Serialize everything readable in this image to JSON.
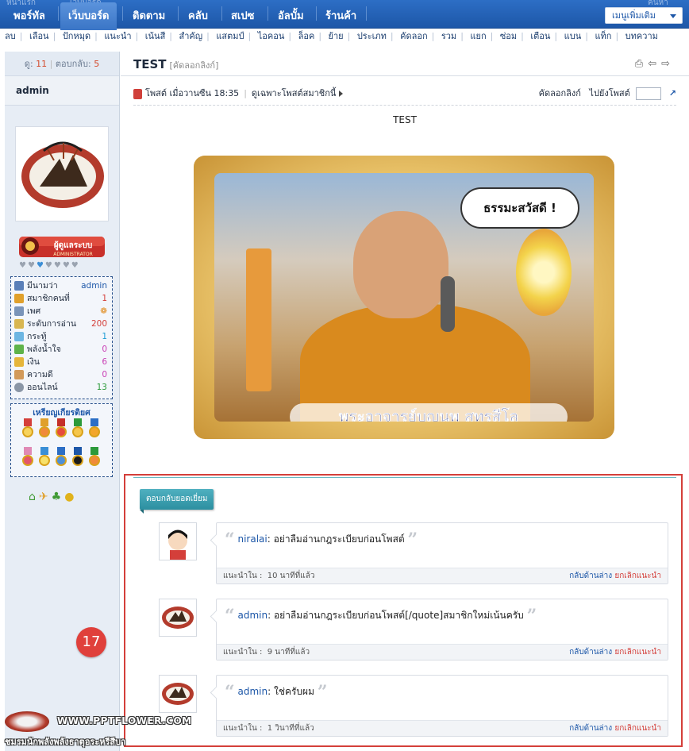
{
  "topnav": {
    "ghost_left": "หน้าแรก",
    "ghost_mid": "เว็บบอร์ด",
    "ghost_right": "ค้นหา",
    "items": [
      "พอร์ทัล",
      "เว็บบอร์ด",
      "ติดตาม",
      "คลับ",
      "สเปซ",
      "อัลบั้ม",
      "ร้านค้า"
    ],
    "more_menu": "เมนูเพิ่มเติม"
  },
  "subnav": [
    "ลบ",
    "เลือน",
    "ปักหมุด",
    "แนะนำ",
    "เน้นสี",
    "สำคัญ",
    "แสตมป์",
    "ไอคอน",
    "ล็อค",
    "ย้าย",
    "ประเภท",
    "คัดลอก",
    "รวม",
    "แยก",
    "ซ่อม",
    "เตือน",
    "แบน",
    "แท็ก",
    "บทความ"
  ],
  "sidebar": {
    "views_label": "ดู:",
    "views": "11",
    "replies_label": "ตอบกลับ:",
    "replies": "5",
    "username": "admin",
    "badge_text": "ผู้ดูแลระบบ",
    "badge_sub": "ADMINISTRATOR",
    "info": [
      {
        "label": "มีนามว่า",
        "value": "admin",
        "color": "#1d57a8"
      },
      {
        "label": "สมาชิกคนที่",
        "value": "1",
        "color": "#d43f3a"
      },
      {
        "label": "เพศ",
        "value": "",
        "color": "#e08a1a"
      },
      {
        "label": "ระดับการอ่าน",
        "value": "200",
        "color": "#d43f3a"
      },
      {
        "label": "กระทู้",
        "value": "1",
        "color": "#1d9bd4"
      },
      {
        "label": "พลังน้ำใจ",
        "value": "0",
        "color": "#c93fb5"
      },
      {
        "label": "เงิน",
        "value": "6",
        "color": "#c93fb5"
      },
      {
        "label": "ความดี",
        "value": "0",
        "color": "#c93fb5"
      },
      {
        "label": "ออนไลน์",
        "value": "13",
        "color": "#2c9a3a"
      }
    ],
    "medals_title": "เหรียญเกียรติยศ"
  },
  "main": {
    "title": "TEST",
    "copy_link_bracket": "[คัดลอกลิงก์]",
    "post_meta": "โพสต์ เมื่อวานซืน 18:35",
    "author_only": "ดูเฉพาะโพสต์สมาชิกนี้",
    "copy_link": "คัดลอกลิงก์",
    "goto_post": "ไปยังโพสต์",
    "post_text": "TEST",
    "bubble_text": "ธรรมะสวัสดี !",
    "caption_text": "พระอาจารย์บุญนพ สุทุรสีโล"
  },
  "recommend": {
    "tab_label": "ตอบกลับยอดเยี่ยม",
    "items": [
      {
        "author": "niralai",
        "message": "อย่าลืมอ่านกฎระเบียบก่อนโพสต์",
        "rec_label": "แนะนำใน :",
        "time": "10 นาทีที่แล้ว",
        "back": "กลับด้านล่าง",
        "cancel": "ยกเลิกแนะนำ"
      },
      {
        "author": "admin",
        "message": "อย่าลืมอ่านกฎระเบียบก่อนโพสต์[/quote]สมาชิกใหม่เน้นครับ",
        "rec_label": "แนะนำใน :",
        "time": "9 นาทีที่แล้ว",
        "back": "กลับด้านล่าง",
        "cancel": "ยกเลิกแนะนำ"
      },
      {
        "author": "admin",
        "message": "ใช่ครับผม",
        "rec_label": "แนะนำใน :",
        "time": "1 วินาทีที่แล้ว",
        "back": "กลับด้านล่าง",
        "cancel": "ยกเลิกแนะนำ"
      }
    ]
  },
  "step_badge": "17",
  "watermark": {
    "url": "WWW.PPTFLOWER.COM",
    "club": "ชมรมนักพลังพลังธาตุอระหรีสีบา"
  }
}
